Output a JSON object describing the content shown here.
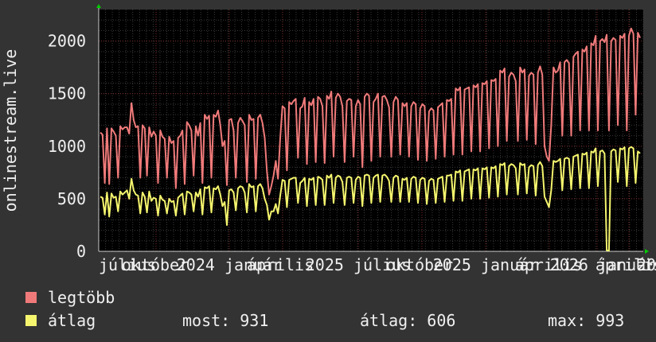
{
  "chart_data": {
    "type": "line",
    "ylabel": "onlinestream.live",
    "ylim": [
      0,
      2300
    ],
    "yticks": [
      0,
      500,
      1000,
      1500,
      2000
    ],
    "xticks": [
      "július",
      "október",
      "2024 január",
      "április",
      "2025 július",
      "október",
      "2025 január",
      "április",
      "2026 január",
      "április",
      "20"
    ],
    "grid": true,
    "legend": "bottom",
    "series": [
      {
        "name": "legtöbb",
        "color": "#f07a7a",
        "values": [
          1130,
          1110,
          650,
          1170,
          640,
          1170,
          1140,
          1100,
          700,
          1190,
          1160,
          1180,
          1180,
          1120,
          1410,
          1250,
          1180,
          1190,
          700,
          1200,
          1170,
          720,
          1180,
          1090,
          1140,
          1100,
          650,
          1150,
          1090,
          1070,
          700,
          1090,
          1030,
          1050,
          600,
          1080,
          1100,
          1150,
          640,
          1230,
          1200,
          1150,
          720,
          1190,
          1100,
          1220,
          650,
          1300,
          1260,
          1290,
          700,
          1300,
          1280,
          1340,
          1200,
          1000,
          1050,
          630,
          1250,
          1260,
          1150,
          700,
          1220,
          1270,
          1240,
          1200,
          660,
          1300,
          1250,
          1260,
          690,
          1270,
          1300,
          1220,
          1080,
          760,
          540,
          620,
          720,
          860,
          690,
          1080,
          1380,
          1360,
          770,
          1420,
          1400,
          1430,
          1450,
          890,
          1360,
          1380,
          1460,
          830,
          1420,
          1390,
          1450,
          850,
          1470,
          1450,
          1380,
          840,
          1480,
          1450,
          1520,
          900,
          1460,
          1500,
          1470,
          1380,
          850,
          1430,
          1450,
          1440,
          900,
          1380,
          1440,
          1400,
          800,
          1470,
          1500,
          1480,
          860,
          1420,
          1450,
          1500,
          900,
          1470,
          1480,
          1440,
          1370,
          900,
          1420,
          1470,
          1440,
          920,
          1410,
          1380,
          1410,
          900,
          1380,
          1420,
          1400,
          870,
          1360,
          1400,
          1380,
          860,
          1330,
          1360,
          1340,
          880,
          1370,
          1390,
          1410,
          900,
          1440,
          1430,
          1450,
          920,
          1550,
          1530,
          1560,
          920,
          1540,
          1550,
          1560,
          950,
          1580,
          1560,
          1590,
          950,
          1600,
          1590,
          1620,
          980,
          1630,
          1620,
          1640,
          1000,
          1720,
          1700,
          1740,
          1050,
          1660,
          1700,
          1680,
          1620,
          1050,
          1750,
          1700,
          1730,
          1060,
          1670,
          1700,
          1680,
          1020,
          1700,
          1760,
          1680,
          1000,
          900,
          860,
          1200,
          1750,
          1700,
          1720,
          1800,
          1100,
          1800,
          1820,
          1790,
          1100,
          1850,
          1880,
          1900,
          1150,
          1920,
          1900,
          1950,
          1150,
          1980,
          1960,
          2050,
          1150,
          2000,
          2020,
          1990,
          2060,
          1150,
          2000,
          2030,
          2010,
          1200,
          2050,
          2030,
          2070,
          1150,
          2050,
          2120,
          2070,
          1300,
          2080,
          2030
        ]
      },
      {
        "name": "átlag",
        "color": "#f5f56e",
        "values": [
          520,
          510,
          350,
          560,
          330,
          550,
          510,
          520,
          380,
          570,
          540,
          560,
          580,
          500,
          690,
          580,
          540,
          530,
          360,
          560,
          520,
          370,
          570,
          480,
          510,
          500,
          340,
          530,
          490,
          480,
          360,
          500,
          470,
          480,
          340,
          510,
          530,
          550,
          350,
          570,
          560,
          540,
          380,
          560,
          520,
          590,
          350,
          610,
          600,
          620,
          370,
          600,
          590,
          620,
          540,
          430,
          470,
          250,
          580,
          590,
          560,
          390,
          600,
          620,
          610,
          560,
          370,
          640,
          610,
          620,
          380,
          620,
          640,
          600,
          500,
          440,
          300,
          380,
          380,
          450,
          360,
          530,
          680,
          670,
          420,
          680,
          690,
          700,
          700,
          460,
          650,
          670,
          700,
          430,
          690,
          680,
          700,
          440,
          710,
          700,
          680,
          440,
          720,
          700,
          730,
          460,
          700,
          720,
          710,
          660,
          440,
          700,
          710,
          700,
          460,
          680,
          710,
          700,
          430,
          720,
          730,
          720,
          460,
          700,
          720,
          730,
          470,
          720,
          730,
          710,
          670,
          470,
          700,
          720,
          710,
          470,
          690,
          680,
          700,
          470,
          690,
          710,
          700,
          460,
          680,
          700,
          690,
          450,
          670,
          690,
          680,
          460,
          690,
          700,
          710,
          470,
          720,
          720,
          730,
          480,
          760,
          750,
          770,
          480,
          760,
          770,
          780,
          500,
          780,
          770,
          790,
          500,
          790,
          780,
          800,
          510,
          800,
          790,
          810,
          520,
          830,
          820,
          840,
          540,
          810,
          830,
          820,
          790,
          540,
          840,
          820,
          830,
          550,
          800,
          820,
          810,
          530,
          820,
          850,
          810,
          520,
          470,
          420,
          580,
          860,
          850,
          860,
          880,
          580,
          880,
          890,
          880,
          590,
          900,
          910,
          920,
          600,
          930,
          920,
          940,
          600,
          950,
          940,
          980,
          620,
          950,
          960,
          930,
          10,
          5,
          950,
          970,
          960,
          660,
          980,
          970,
          990,
          620,
          980,
          993,
          980,
          650,
          950,
          931
        ]
      }
    ]
  },
  "legend": {
    "items": [
      {
        "label": "legtöbb",
        "color": "#f07a7a"
      },
      {
        "label": "átlag",
        "color": "#f5f56e"
      }
    ],
    "stats": {
      "most": "most: 931",
      "atlag": "átlag: 606",
      "max": "max: 993"
    }
  },
  "colors": {
    "background": "#333333",
    "plot_bg": "#000000",
    "grid_major": "#7a2a2a",
    "grid_minor": "#3a3a3a",
    "text": "#f0f0f0",
    "arrow": "#00cc00"
  }
}
